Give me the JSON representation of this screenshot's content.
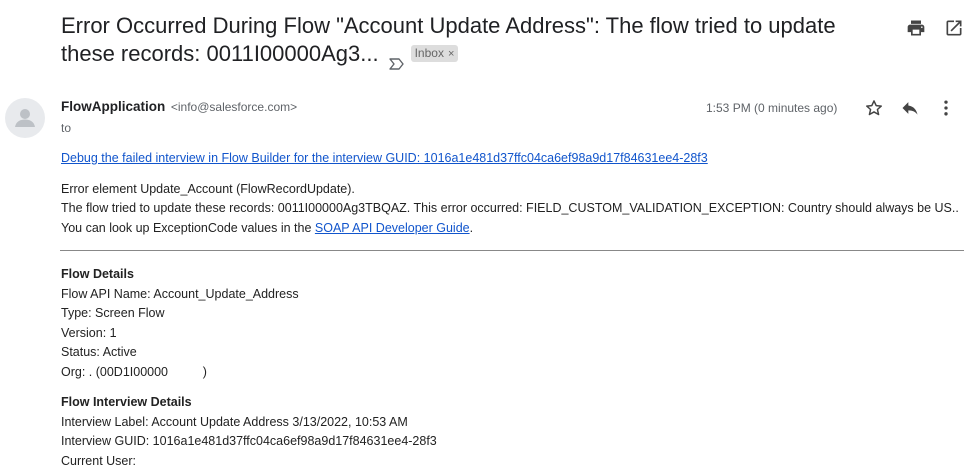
{
  "email": {
    "subject": "Error Occurred During Flow \"Account Update Address\": The flow tried to update these records: 0011I00000Ag3...",
    "label": "Inbox",
    "label_close": "×",
    "sender_name": "FlowApplication",
    "sender_email": "<info@salesforce.com>",
    "to": "to",
    "timestamp": "1:53 PM (0 minutes ago)"
  },
  "body": {
    "debug_link": "Debug the failed interview in Flow Builder for the interview GUID: 1016a1e481d37ffc04ca6ef98a9d17f84631ee4-28f3",
    "error_element": "Error element Update_Account (FlowRecordUpdate).",
    "error_text": "The flow tried to update these records: 0011I00000Ag3TBQAZ. This error occurred: FIELD_CUSTOM_VALIDATION_EXCEPTION: Country should always be US.. You can look up ExceptionCode values in the ",
    "soap_link": "SOAP API Developer Guide",
    "error_end": ".",
    "flow_details_title": "Flow Details",
    "flow_details": [
      "Flow API Name: Account_Update_Address",
      "Type: Screen Flow",
      "Version: 1",
      "Status: Active",
      "Org: . (00D1I00000          )"
    ],
    "interview_title": "Flow Interview Details",
    "interview_details": [
      "Interview Label: Account Update Address 3/13/2022, 10:53 AM",
      "Interview GUID: 1016a1e481d37ffc04ca6ef98a9d17f84631ee4-28f3",
      "Current User:"
    ]
  },
  "icons": {
    "print": "print-icon",
    "open_new": "open-in-new-window-icon",
    "star": "star-icon",
    "reply": "reply-icon",
    "more": "more-vert-icon",
    "avatar": "person-icon",
    "important": "important-marker-icon"
  }
}
